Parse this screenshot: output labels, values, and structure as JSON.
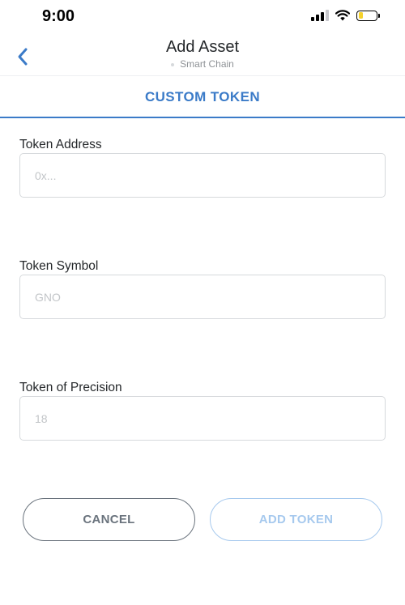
{
  "status_bar": {
    "time": "9:00",
    "battery_level": 0.25,
    "battery_color": "#f5d22d"
  },
  "header": {
    "back_icon": "chevron-left-icon",
    "title": "Add Asset",
    "network": "Smart Chain"
  },
  "tabs": {
    "active": "CUSTOM TOKEN"
  },
  "form": {
    "address_label": "Token Address",
    "address_placeholder": "0x...",
    "symbol_label": "Token Symbol",
    "symbol_placeholder": "GNO",
    "precision_label": "Token of Precision",
    "precision_placeholder": "18"
  },
  "buttons": {
    "cancel": "CANCEL",
    "add_token": "ADD TOKEN"
  },
  "colors": {
    "accent": "#3b7bc8",
    "disabled_button": "#a6c9ee",
    "cancel_button": "#6a737d"
  }
}
